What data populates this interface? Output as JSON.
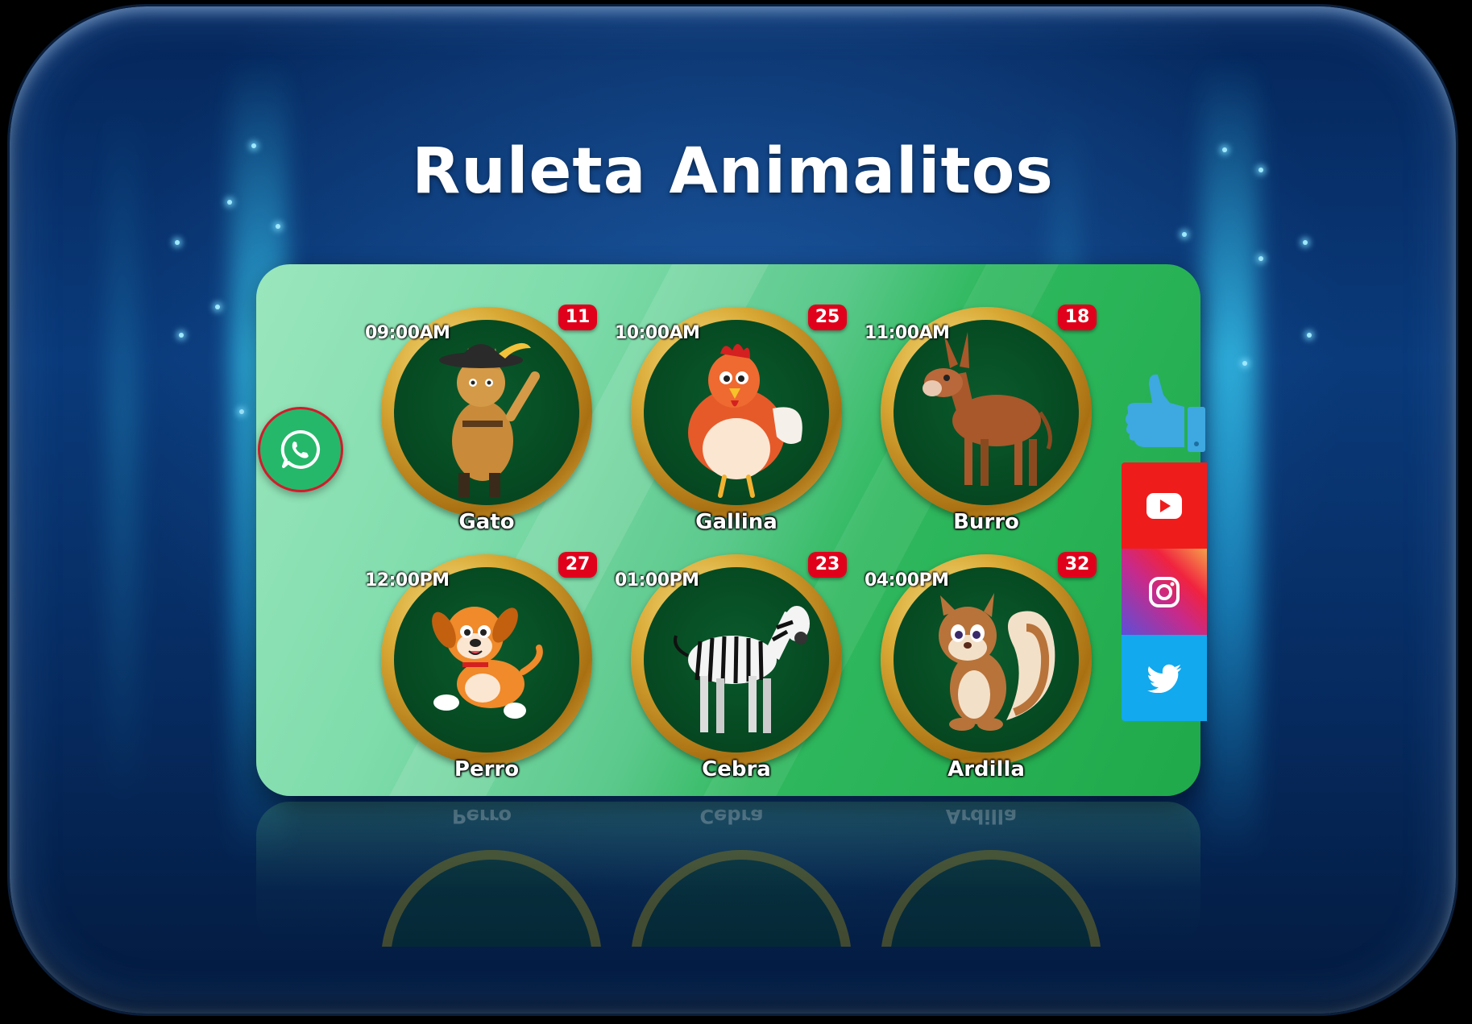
{
  "title": "Ruleta Animalitos",
  "colors": {
    "background": "#0a3a7a",
    "panel": "#5cc98c",
    "badge": "#e0001b",
    "ring_gold": "#d9a935",
    "whatsapp": "#25b86a",
    "youtube": "#ef1c1c",
    "twitter": "#12a9ee"
  },
  "cards": [
    {
      "time": "09:00AM",
      "number": "11",
      "name": "Gato",
      "icon": "cat-icon"
    },
    {
      "time": "10:00AM",
      "number": "25",
      "name": "Gallina",
      "icon": "hen-icon"
    },
    {
      "time": "11:00AM",
      "number": "18",
      "name": "Burro",
      "icon": "donkey-icon"
    },
    {
      "time": "12:00PM",
      "number": "27",
      "name": "Perro",
      "icon": "dog-icon"
    },
    {
      "time": "01:00PM",
      "number": "23",
      "name": "Cebra",
      "icon": "zebra-icon"
    },
    {
      "time": "04:00PM",
      "number": "32",
      "name": "Ardilla",
      "icon": "squirrel-icon"
    }
  ],
  "side_buttons": {
    "whatsapp": "whatsapp-icon",
    "like": "thumbs-up-icon",
    "youtube": "youtube-icon",
    "instagram": "instagram-icon",
    "twitter": "twitter-icon"
  }
}
